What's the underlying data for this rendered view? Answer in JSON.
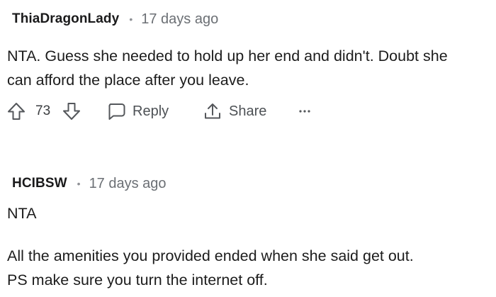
{
  "comments": [
    {
      "author": "ThiaDragonLady",
      "separator": "•",
      "time": "17 days ago",
      "lines": [
        "NTA. Guess she needed to hold up her end and didn't. Doubt she",
        "can afford the place after you leave."
      ],
      "score": "73",
      "reply_label": "Reply",
      "share_label": "Share",
      "more_label": "···",
      "icons": {
        "upvote": "upvote-arrow-icon",
        "downvote": "downvote-arrow-icon",
        "reply": "speech-bubble-icon",
        "share": "share-arrow-icon",
        "more": "more-dots-icon"
      }
    },
    {
      "author": "HCIBSW",
      "separator": "•",
      "time": "17 days ago",
      "paragraphs": [
        [
          "NTA"
        ],
        [
          "All the amenities you provided ended when she said get out.",
          "PS make sure you turn the internet off."
        ]
      ]
    }
  ],
  "colors": {
    "text": "#1c1c1c",
    "meta": "#6b6f74",
    "icon": "#54575b",
    "background": "#ffffff"
  }
}
